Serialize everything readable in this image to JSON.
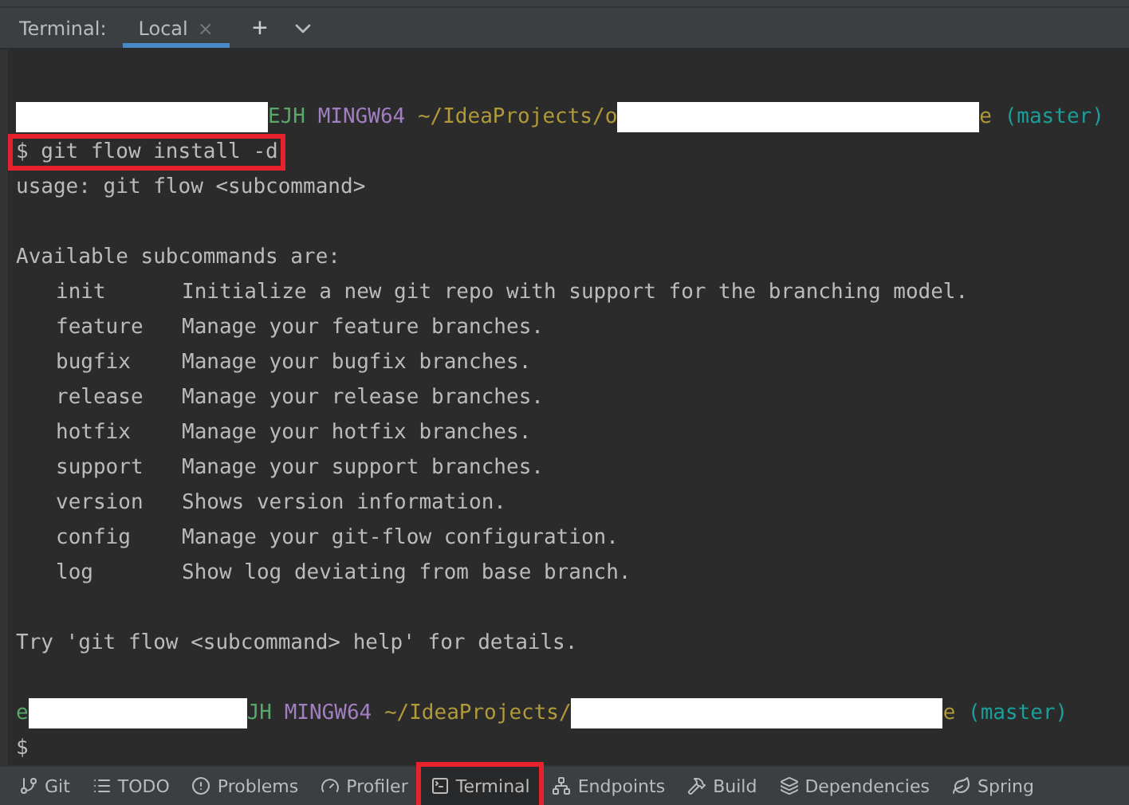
{
  "tool_window": {
    "title": "Terminal:",
    "tabs": [
      {
        "label": "Local",
        "selected": true,
        "close": "×"
      }
    ],
    "new_tab": "+"
  },
  "terminal": {
    "lines": [
      {
        "kind": "blank"
      },
      {
        "kind": "prompt",
        "user_tail": "EJH",
        "host": "MINGW64",
        "path_head": "~/IdeaProjects/o",
        "path_tail": "e",
        "branch": "(master)"
      },
      {
        "kind": "command",
        "text": "$ git flow install -d",
        "highlighted": true
      },
      {
        "kind": "text",
        "text": "usage: git flow <subcommand>"
      },
      {
        "kind": "blank"
      },
      {
        "kind": "text",
        "text": "Available subcommands are:"
      },
      {
        "kind": "sub",
        "name": "init",
        "desc": "Initialize a new git repo with support for the branching model."
      },
      {
        "kind": "sub",
        "name": "feature",
        "desc": "Manage your feature branches."
      },
      {
        "kind": "sub",
        "name": "bugfix",
        "desc": "Manage your bugfix branches."
      },
      {
        "kind": "sub",
        "name": "release",
        "desc": "Manage your release branches."
      },
      {
        "kind": "sub",
        "name": "hotfix",
        "desc": "Manage your hotfix branches."
      },
      {
        "kind": "sub",
        "name": "support",
        "desc": "Manage your support branches."
      },
      {
        "kind": "sub",
        "name": "version",
        "desc": "Shows version information."
      },
      {
        "kind": "sub",
        "name": "config",
        "desc": "Manage your git-flow configuration."
      },
      {
        "kind": "sub",
        "name": "log",
        "desc": "Show log deviating from base branch."
      },
      {
        "kind": "blank"
      },
      {
        "kind": "text",
        "text": "Try 'git flow <subcommand> help' for details."
      },
      {
        "kind": "blank"
      },
      {
        "kind": "prompt",
        "user_head": "e",
        "user_tail": "JH",
        "host": "MINGW64",
        "path_head": "~/IdeaProjects/",
        "path_tail": "e",
        "branch": "(master)"
      },
      {
        "kind": "command",
        "text": "$",
        "highlighted": false
      }
    ]
  },
  "toolbar": [
    {
      "label": "Git",
      "selected": false
    },
    {
      "label": "TODO",
      "selected": false
    },
    {
      "label": "Problems",
      "selected": false
    },
    {
      "label": "Profiler",
      "selected": false
    },
    {
      "label": "Terminal",
      "selected": true
    },
    {
      "label": "Endpoints",
      "selected": false
    },
    {
      "label": "Build",
      "selected": false
    },
    {
      "label": "Dependencies",
      "selected": false
    },
    {
      "label": "Spring",
      "selected": false
    }
  ]
}
